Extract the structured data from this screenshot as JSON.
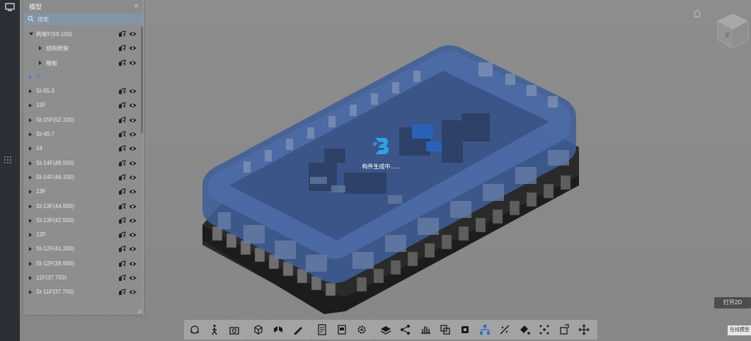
{
  "panel": {
    "title": "模型",
    "close": "×",
    "search_placeholder": "搜索"
  },
  "tree": {
    "items": [
      {
        "label": "构架F(59.100)",
        "level": 0,
        "expanded": true,
        "selected": false
      },
      {
        "label": "结构框架",
        "level": 1,
        "expanded": false,
        "selected": false
      },
      {
        "label": "楼板",
        "level": 1,
        "expanded": false,
        "selected": false
      },
      {
        "label": "R",
        "level": 0,
        "expanded": false,
        "selected": true
      },
      {
        "label": "St-55.3",
        "level": 0,
        "expanded": false,
        "selected": false
      },
      {
        "label": "15F",
        "level": 0,
        "expanded": false,
        "selected": false
      },
      {
        "label": "St-15F(52.100)",
        "level": 0,
        "expanded": false,
        "selected": false
      },
      {
        "label": "St-49.7",
        "level": 0,
        "expanded": false,
        "selected": false
      },
      {
        "label": "14",
        "level": 0,
        "expanded": false,
        "selected": false
      },
      {
        "label": "St-14F(48.500)",
        "level": 0,
        "expanded": false,
        "selected": false
      },
      {
        "label": "St-14F(46.100)",
        "level": 0,
        "expanded": false,
        "selected": false
      },
      {
        "label": "13F",
        "level": 0,
        "expanded": false,
        "selected": false
      },
      {
        "label": "St-13F(44.900)",
        "level": 0,
        "expanded": false,
        "selected": false
      },
      {
        "label": "St-13F(42.500)",
        "level": 0,
        "expanded": false,
        "selected": false
      },
      {
        "label": "12F",
        "level": 0,
        "expanded": false,
        "selected": false
      },
      {
        "label": "St-12F(41.300)",
        "level": 0,
        "expanded": false,
        "selected": false
      },
      {
        "label": "St-12F(38.900)",
        "level": 0,
        "expanded": false,
        "selected": false
      },
      {
        "label": "11F(37.750)",
        "level": 0,
        "expanded": false,
        "selected": false
      },
      {
        "label": "St-11F(37.700)",
        "level": 0,
        "expanded": false,
        "selected": false
      }
    ]
  },
  "loading": {
    "text": "构件生成中......"
  },
  "viewcube": {
    "face_label": "前"
  },
  "buttons": {
    "open_2d": "打开2D",
    "status": "在线模型"
  },
  "toolbar": {
    "groups": [
      [
        "orbit-icon",
        "walk-icon",
        "camera-icon"
      ],
      [
        "cube-add-icon",
        "explode-icon",
        "pen-icon"
      ],
      [
        "document-icon",
        "layers-icon",
        "gear-icon"
      ],
      [
        "stack-icon",
        "share-icon",
        "hand-icon",
        "copy-icon",
        "box-icon",
        "hierarchy-icon",
        "measure-icon",
        "paint-icon",
        "scatter-icon",
        "rotate-icon",
        "move-icon"
      ]
    ]
  },
  "colors": {
    "accent": "#3c7fd4",
    "model_blue": "#3f5f98",
    "background": "#8a8a8a",
    "sidebar": "#2b2f36"
  }
}
